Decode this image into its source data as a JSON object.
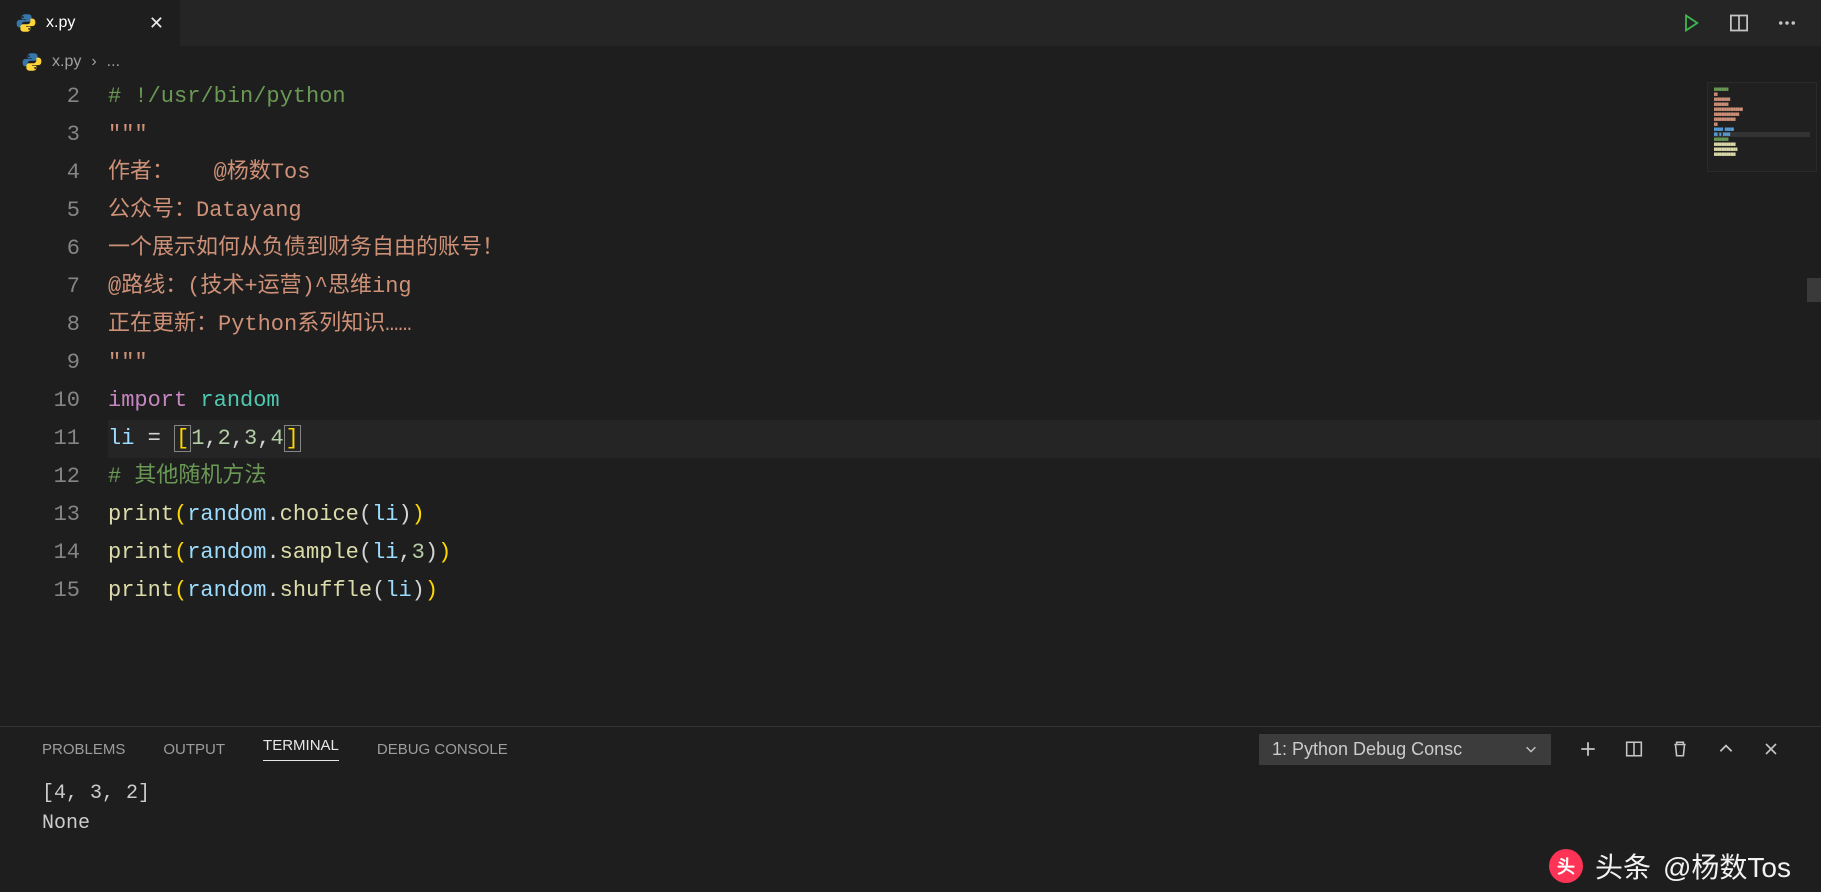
{
  "tab": {
    "filename": "x.py"
  },
  "breadcrumb": {
    "file": "x.py",
    "sep": "›",
    "rest": "..."
  },
  "actions": {
    "run": "run-icon",
    "split": "split-icon",
    "more": "more-icon"
  },
  "editor": {
    "linenos": [
      "2",
      "3",
      "4",
      "5",
      "6",
      "7",
      "8",
      "9",
      "10",
      "11",
      "12",
      "13",
      "14",
      "15"
    ],
    "current_line_index": 9,
    "lines": [
      [
        {
          "cls": "tok-comment",
          "t": "# !/usr/bin/python"
        }
      ],
      [
        {
          "cls": "tok-string",
          "t": "\"\"\""
        }
      ],
      [
        {
          "cls": "tok-string",
          "t": "作者：   @杨数Tos"
        }
      ],
      [
        {
          "cls": "tok-string",
          "t": "公众号：Datayang"
        }
      ],
      [
        {
          "cls": "tok-string",
          "t": "一个展示如何从负债到财务自由的账号！"
        }
      ],
      [
        {
          "cls": "tok-string",
          "t": "@路线：(技术+运营)^思维ing"
        }
      ],
      [
        {
          "cls": "tok-string",
          "t": "正在更新：Python系列知识……"
        }
      ],
      [
        {
          "cls": "tok-string",
          "t": "\"\"\""
        }
      ],
      [
        {
          "cls": "tok-keyword",
          "t": "import"
        },
        {
          "cls": "tok-op",
          "t": " "
        },
        {
          "cls": "tok-module",
          "t": "random"
        }
      ],
      [
        {
          "cls": "tok-var",
          "t": "li"
        },
        {
          "cls": "tok-op",
          "t": " = "
        },
        {
          "cls": "tok-bracket bracket-box",
          "t": "["
        },
        {
          "cls": "tok-num",
          "t": "1"
        },
        {
          "cls": "tok-punct",
          "t": ","
        },
        {
          "cls": "tok-num",
          "t": "2"
        },
        {
          "cls": "tok-punct",
          "t": ","
        },
        {
          "cls": "tok-num",
          "t": "3"
        },
        {
          "cls": "tok-punct",
          "t": ","
        },
        {
          "cls": "tok-num",
          "t": "4"
        },
        {
          "cls": "tok-bracket bracket-box",
          "t": "]"
        }
      ],
      [
        {
          "cls": "tok-comment",
          "t": "# 其他随机方法"
        }
      ],
      [
        {
          "cls": "tok-func",
          "t": "print"
        },
        {
          "cls": "tok-bracket",
          "t": "("
        },
        {
          "cls": "tok-var",
          "t": "random"
        },
        {
          "cls": "tok-punct",
          "t": "."
        },
        {
          "cls": "tok-func",
          "t": "choice"
        },
        {
          "cls": "tok-punct",
          "t": "("
        },
        {
          "cls": "tok-var",
          "t": "li"
        },
        {
          "cls": "tok-punct",
          "t": ")"
        },
        {
          "cls": "tok-bracket",
          "t": ")"
        }
      ],
      [
        {
          "cls": "tok-func",
          "t": "print"
        },
        {
          "cls": "tok-bracket",
          "t": "("
        },
        {
          "cls": "tok-var",
          "t": "random"
        },
        {
          "cls": "tok-punct",
          "t": "."
        },
        {
          "cls": "tok-func",
          "t": "sample"
        },
        {
          "cls": "tok-punct",
          "t": "("
        },
        {
          "cls": "tok-var",
          "t": "li"
        },
        {
          "cls": "tok-punct",
          "t": ","
        },
        {
          "cls": "tok-num",
          "t": "3"
        },
        {
          "cls": "tok-punct",
          "t": ")"
        },
        {
          "cls": "tok-bracket",
          "t": ")"
        }
      ],
      [
        {
          "cls": "tok-func",
          "t": "print"
        },
        {
          "cls": "tok-bracket",
          "t": "("
        },
        {
          "cls": "tok-var",
          "t": "random"
        },
        {
          "cls": "tok-punct",
          "t": "."
        },
        {
          "cls": "tok-func",
          "t": "shuffle"
        },
        {
          "cls": "tok-punct",
          "t": "("
        },
        {
          "cls": "tok-var",
          "t": "li"
        },
        {
          "cls": "tok-punct",
          "t": ")"
        },
        {
          "cls": "tok-bracket",
          "t": ")"
        }
      ]
    ]
  },
  "panel": {
    "tabs": {
      "problems": "PROBLEMS",
      "output": "OUTPUT",
      "terminal": "TERMINAL",
      "debug": "DEBUG CONSOLE"
    },
    "selector": "1: Python Debug Consc",
    "output_lines": [
      "[4, 3, 2]",
      "None"
    ]
  },
  "watermark": {
    "label": "头条",
    "handle": "@杨数Tos"
  }
}
